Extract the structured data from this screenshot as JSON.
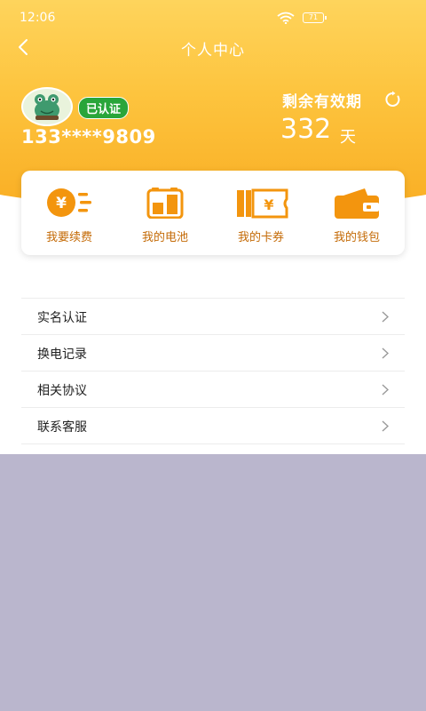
{
  "status_bar": {
    "time": "12:06",
    "battery": "71"
  },
  "header": {
    "title": "个人中心"
  },
  "profile": {
    "verified_label": "已认证",
    "phone": "133****9809",
    "validity_label": "剩余有效期",
    "days_value": "332",
    "days_unit": "天"
  },
  "quick_actions": [
    {
      "label": "我要续费",
      "icon": "yen-coin-icon"
    },
    {
      "label": "我的电池",
      "icon": "battery-icon"
    },
    {
      "label": "我的卡券",
      "icon": "ticket-icon"
    },
    {
      "label": "我的钱包",
      "icon": "wallet-icon"
    }
  ],
  "menu": [
    {
      "label": "实名认证"
    },
    {
      "label": "换电记录"
    },
    {
      "label": "相关协议"
    },
    {
      "label": "联系客服"
    }
  ],
  "colors": {
    "header_top": "#fed45c",
    "header_bottom": "#f9ae24",
    "accent": "#f3950e",
    "badge": "#29a53a",
    "overlay": "#bab6cd"
  }
}
